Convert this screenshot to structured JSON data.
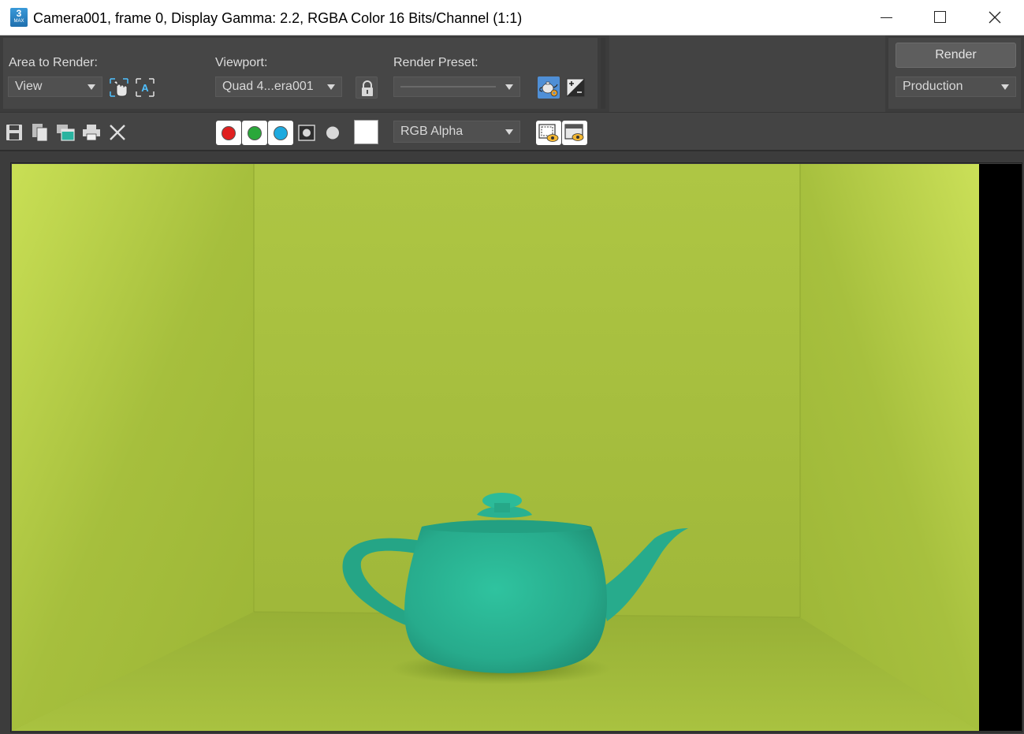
{
  "window": {
    "app_icon_number": "3",
    "app_icon_caption": "MAX",
    "title": "Camera001, frame 0, Display Gamma: 2.2, RGBA Color 16 Bits/Channel (1:1)"
  },
  "options": {
    "area_to_render": {
      "label": "Area to Render:",
      "value": "View"
    },
    "viewport": {
      "label": "Viewport:",
      "value": "Quad 4...era001"
    },
    "render_preset": {
      "label": "Render Preset:",
      "value": ""
    },
    "render_button": "Render",
    "render_mode": "Production"
  },
  "toolbar": {
    "channel_display": "RGB Alpha",
    "swatch_color": "#ffffff"
  },
  "colors": {
    "panel": "#464646",
    "toolbar": "#444444",
    "red_channel": "#e02020",
    "green_channel": "#2aa83a",
    "blue_channel": "#1eaadf",
    "wall": "#a9c23e",
    "teapot": "#2bb596",
    "accent": "#4f8fd6"
  }
}
